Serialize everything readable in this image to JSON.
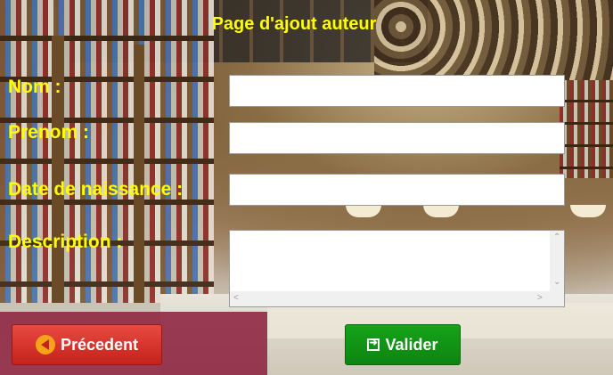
{
  "page": {
    "title": "Page d'ajout auteur"
  },
  "form": {
    "nom_label": "Nom :",
    "nom_value": "",
    "prenom_label": "Prenom :",
    "prenom_value": "",
    "date_label": "Date de naissance :",
    "date_value": "",
    "description_label": "Description :",
    "description_value": ""
  },
  "buttons": {
    "previous_label": "Précedent",
    "validate_label": "Valider"
  },
  "icons": {
    "previous": "back-arrow-icon",
    "validate": "enter-icon"
  },
  "colors": {
    "label_yellow": "#ffff00",
    "previous_red": "#d6332b",
    "validate_green": "#129916"
  }
}
